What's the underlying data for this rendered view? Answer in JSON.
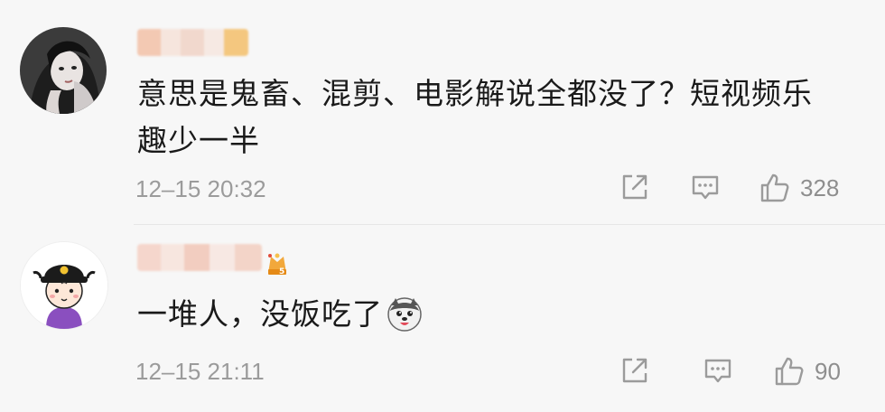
{
  "comments": [
    {
      "avatar": "portrait-avatar",
      "username": "",
      "content": "意思是鬼畜、混剪、电影解说全都没了？短视频乐趣少一半",
      "timestamp": "12–15 20:32",
      "likes": "328"
    },
    {
      "avatar": "cartoon-official-avatar",
      "username": "",
      "badge": "level-5-badge",
      "content": "一堆人，没饭吃了",
      "emoji": "husky-emoji",
      "timestamp": "12–15 21:11",
      "likes": "90"
    }
  ],
  "icons": {
    "share": "share-icon",
    "reply": "reply-icon",
    "like": "thumbs-up-icon"
  },
  "colors": {
    "background": "#f7f7f7",
    "text": "#1a1a1a",
    "muted": "#9b9b9b",
    "badge": "#f2a83b"
  }
}
